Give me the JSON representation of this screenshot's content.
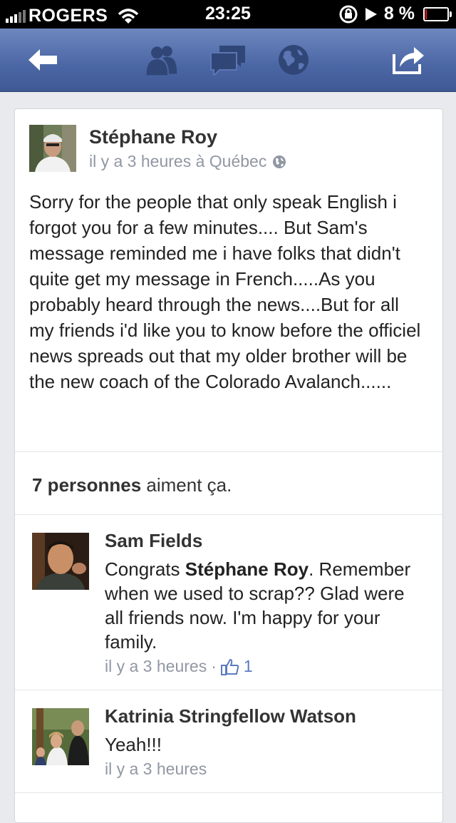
{
  "status_bar": {
    "carrier": "ROGERS",
    "time": "23:25",
    "battery": "8 %",
    "battery_level": 0.08
  },
  "nav": {
    "icons": [
      "back-arrow-icon",
      "friends-icon",
      "messages-icon",
      "globe-icon",
      "share-icon"
    ]
  },
  "post": {
    "author": "Stéphane Roy",
    "meta": "il y a 3 heures à Québec",
    "text": "Sorry for the people that only speak English i forgot you for a few minutes.... But Sam's message reminded me i have folks that didn't quite get my message in French.....As you probably heard through the news....But for all my friends i'd like you to know before the officiel news spreads out that my older brother will be the new coach of the Colorado Avalanch......",
    "likes_bold": "7 personnes",
    "likes_rest": "aiment ça."
  },
  "comments": [
    {
      "author": "Sam Fields",
      "text_pre": "Congrats ",
      "mention": "Stéphane Roy",
      "text_post": ". Remember when we used to scrap?? Glad were all friends now. I'm happy for your family.",
      "time": "il y a 3 heures",
      "separator": "·",
      "like_count": "1"
    },
    {
      "author": "Katrinia Stringfellow Watson",
      "text": "Yeah!!!",
      "time": "il y a 3 heures"
    }
  ]
}
